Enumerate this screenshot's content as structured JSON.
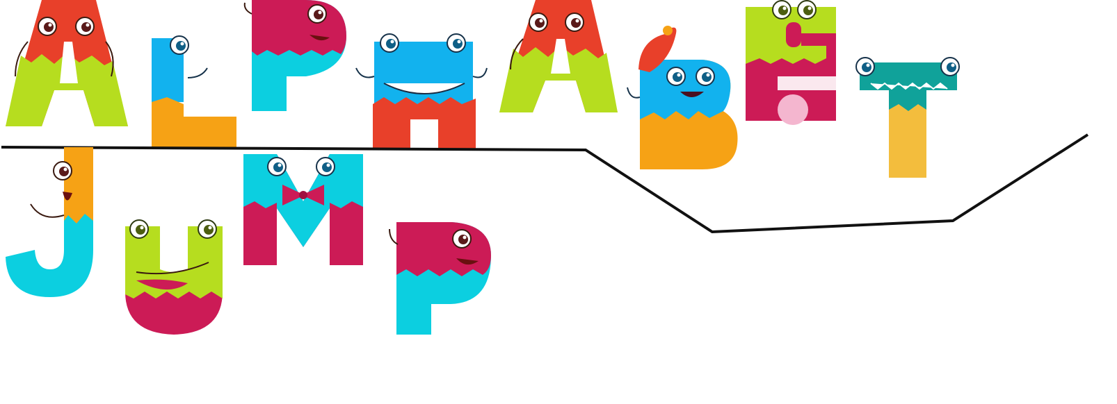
{
  "game": {
    "title_row1": [
      "A",
      "L",
      "P",
      "H",
      "A",
      "B",
      "E",
      "T"
    ],
    "title_row2": [
      "J",
      "U",
      "M",
      "P"
    ]
  },
  "colors": {
    "lime": "#b6dd1f",
    "red": "#e8402a",
    "blue": "#12b2ee",
    "cyan": "#0ccfe0",
    "magenta": "#cc1b56",
    "orange": "#f6a215",
    "teal": "#10a29a",
    "yellow": "#f3bd3d",
    "platform": "#111111"
  }
}
